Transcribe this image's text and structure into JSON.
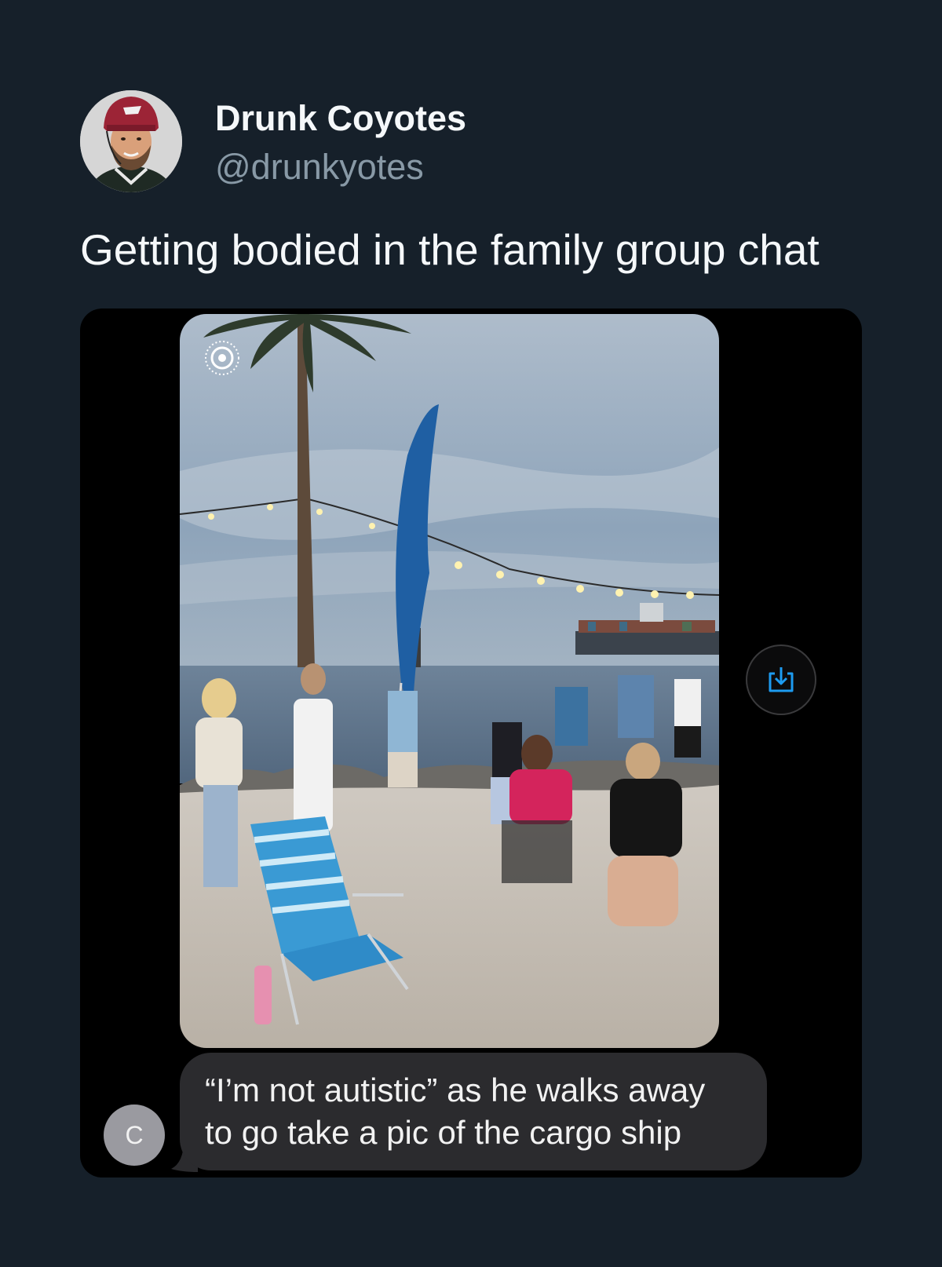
{
  "tweet": {
    "display_name": "Drunk Coyotes",
    "handle": "@drunkyotes",
    "text": "Getting bodied in the family group chat"
  },
  "media": {
    "avatar_icon": "hockey-player-avatar",
    "live_photo_icon": "live-photo-icon",
    "save_icon": "download-icon",
    "message": {
      "sender_initial": "C",
      "line1": "“I’m not autistic” as he walks away",
      "line2": "to go take a pic of the cargo ship"
    }
  },
  "colors": {
    "background": "#16202a",
    "card": "#000000",
    "bubble": "#2b2b2e",
    "accent": "#1d9bf0"
  }
}
